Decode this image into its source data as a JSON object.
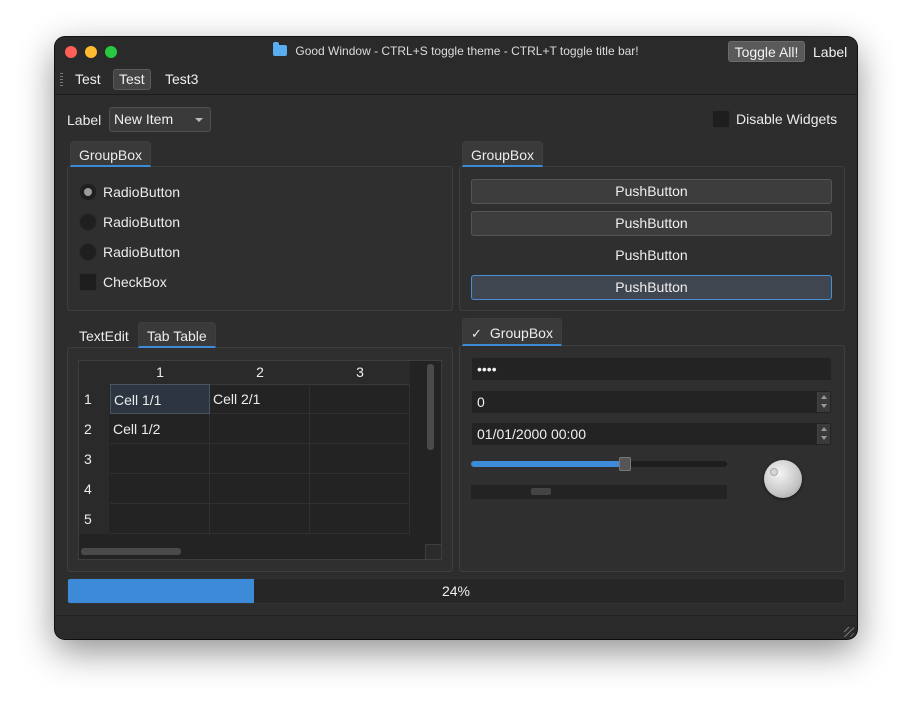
{
  "window": {
    "title": "Good Window - CTRL+S toggle theme - CTRL+T toggle title bar!",
    "toggle_all_label": "Toggle All!",
    "titlebar_label": "Label"
  },
  "menubar": {
    "items": [
      {
        "label": "Test"
      },
      {
        "label": "Test"
      },
      {
        "label": "Test3"
      }
    ]
  },
  "toolbar": {
    "label": "Label",
    "combo_value": "New Item",
    "disable_widgets_label": "Disable Widgets",
    "disable_widgets_checked": false
  },
  "left_group": {
    "title": "GroupBox",
    "radios": [
      {
        "label": "RadioButton",
        "checked": true
      },
      {
        "label": "RadioButton",
        "checked": false
      },
      {
        "label": "RadioButton",
        "checked": false
      }
    ],
    "checkbox": {
      "label": "CheckBox",
      "checked": false
    }
  },
  "right_group": {
    "title": "GroupBox",
    "buttons": [
      {
        "label": "PushButton"
      },
      {
        "label": "PushButton"
      },
      {
        "label": "PushButton"
      },
      {
        "label": "PushButton"
      }
    ]
  },
  "tabs": {
    "items": [
      {
        "label": "TextEdit"
      },
      {
        "label": "Tab Table"
      }
    ],
    "selected": 1
  },
  "table": {
    "columns": [
      "1",
      "2",
      "3"
    ],
    "rows": [
      {
        "header": "1",
        "cells": [
          "Cell 1/1",
          "Cell 2/1",
          ""
        ]
      },
      {
        "header": "2",
        "cells": [
          "Cell 1/2",
          "",
          ""
        ]
      },
      {
        "header": "3",
        "cells": [
          "",
          "",
          ""
        ]
      },
      {
        "header": "4",
        "cells": [
          "",
          "",
          ""
        ]
      },
      {
        "header": "5",
        "cells": [
          "",
          "",
          ""
        ]
      }
    ]
  },
  "check_group": {
    "title": "GroupBox",
    "checked": true,
    "password_display": "••••",
    "spin_value": "0",
    "datetime_value": "01/01/2000 00:00",
    "slider_value_fraction": 0.6
  },
  "progress": {
    "value_percent": 24,
    "text": "24%"
  },
  "colors": {
    "accent": "#3d8bd8",
    "window_bg": "#2d2d2d",
    "close": "#ff5f57",
    "minimize": "#febc2e",
    "maximize": "#28c840"
  }
}
